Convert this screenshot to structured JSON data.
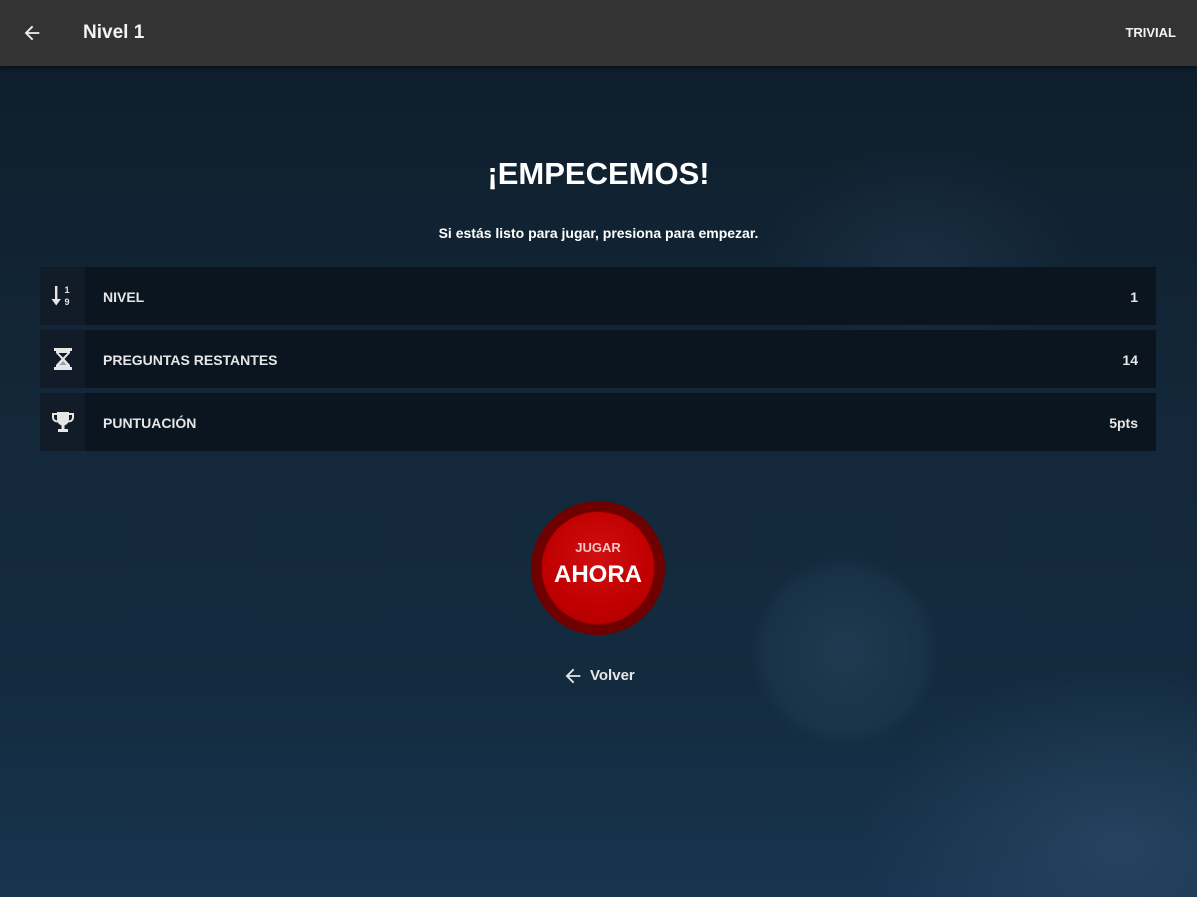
{
  "appbar": {
    "title": "Nivel 1",
    "action_label": "TRIVIAL"
  },
  "main": {
    "heading": "¡EMPECEMOS!",
    "subheading": "Si estás listo para jugar, presiona para empezar.",
    "stats": [
      {
        "icon": "sort-numeric-icon",
        "label": "NIVEL",
        "value": "1"
      },
      {
        "icon": "hourglass-icon",
        "label": "PREGUNTAS RESTANTES",
        "value": "14"
      },
      {
        "icon": "trophy-icon",
        "label": "PUNTUACIÓN",
        "value": "5pts"
      }
    ],
    "play_button": {
      "small_label": "JUGAR",
      "big_label": "AHORA"
    },
    "back_link": {
      "label": "Volver"
    }
  },
  "colors": {
    "appbar": "#333333",
    "background": "#13283a",
    "button": "#c00000",
    "button_ring": "#6e0000"
  }
}
